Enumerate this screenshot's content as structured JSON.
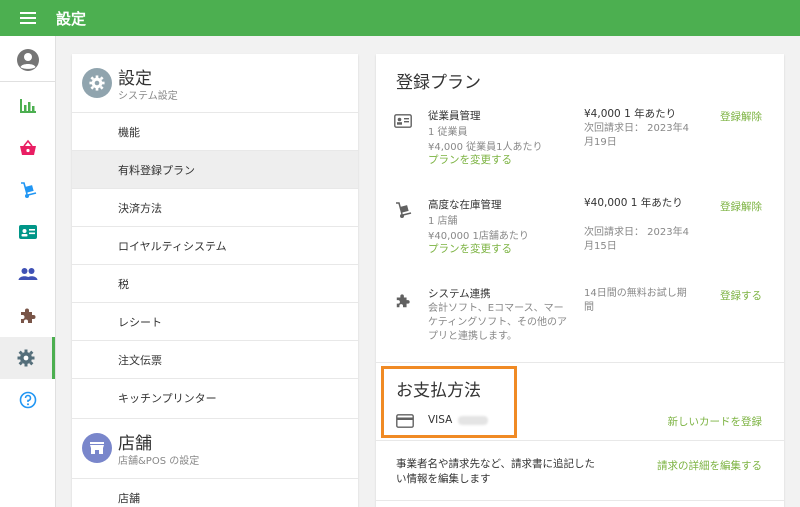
{
  "topbar": {
    "title": "設定",
    "menu_icon": "hamburger-menu-icon"
  },
  "rail": {
    "items": [
      {
        "name": "account",
        "icon": "account-circle-icon",
        "color": "#757575"
      },
      {
        "name": "reports",
        "icon": "bar-chart-icon",
        "color": "#4caf50"
      },
      {
        "name": "items",
        "icon": "basket-icon",
        "color": "#e91e63"
      },
      {
        "name": "inventory",
        "icon": "hand-truck-icon",
        "color": "#2196f3"
      },
      {
        "name": "employees",
        "icon": "id-card-icon",
        "color": "#009688"
      },
      {
        "name": "customers",
        "icon": "people-icon",
        "color": "#3f51b5"
      },
      {
        "name": "integrations",
        "icon": "puzzle-icon",
        "color": "#795548"
      },
      {
        "name": "settings",
        "icon": "gear-icon",
        "color": "#546e7a"
      },
      {
        "name": "help",
        "icon": "help-circle-icon",
        "color": "#2196f3"
      }
    ],
    "active_index": 7
  },
  "left": {
    "system": {
      "title": "設定",
      "subtitle": "システム設定",
      "icon": "gear-icon",
      "icon_color": "#90a4ae",
      "items": [
        "機能",
        "有料登録プラン",
        "決済方法",
        "ロイヤルティシステム",
        "税",
        "レシート",
        "注文伝票",
        "キッチンプリンター"
      ],
      "selected_index": 1
    },
    "store": {
      "title": "店舗",
      "subtitle": "店舗&POS の設定",
      "icon": "store-icon",
      "icon_color": "#7986cb",
      "items": [
        "店舗"
      ]
    }
  },
  "plans": {
    "title": "登録プラン",
    "employees": {
      "icon": "id-badge-icon",
      "name": "従業員管理",
      "line1": "1 従業員",
      "line2": "¥4,000 従業員1人あたり",
      "change_label": "プランを変更する",
      "price": "¥4,000 1 年あたり",
      "next": "次回請求日： 2023年4月19日",
      "action": "登録解除"
    },
    "inventory": {
      "icon": "hand-truck-icon",
      "name": "高度な在庫管理",
      "line1": "1 店舗",
      "line2": "¥40,000 1店舗あたり",
      "change_label": "プランを変更する",
      "price": "¥40,000 1 年あたり",
      "next": "次回請求日： 2023年4月15日",
      "action": "登録解除"
    },
    "integration": {
      "icon": "puzzle-icon",
      "name": "システム連携",
      "description": "会計ソフト、Eコマース、マーケティングソフト、その他のアプリと連携します。",
      "trial": "14日間の無料お試し期間",
      "action": "登録する"
    }
  },
  "payment": {
    "title": "お支払方法",
    "card_icon": "credit-card-icon",
    "card_brand": "VISA",
    "new_card_label": "新しいカードを登録",
    "invoice_text": "事業者名や請求先など、請求書に追記したい情報を編集します",
    "invoice_edit_label": "請求の詳細を編集する"
  },
  "colors": {
    "topbar": "#4caf50",
    "link": "#7cb342",
    "highlight": "#f08a24"
  }
}
